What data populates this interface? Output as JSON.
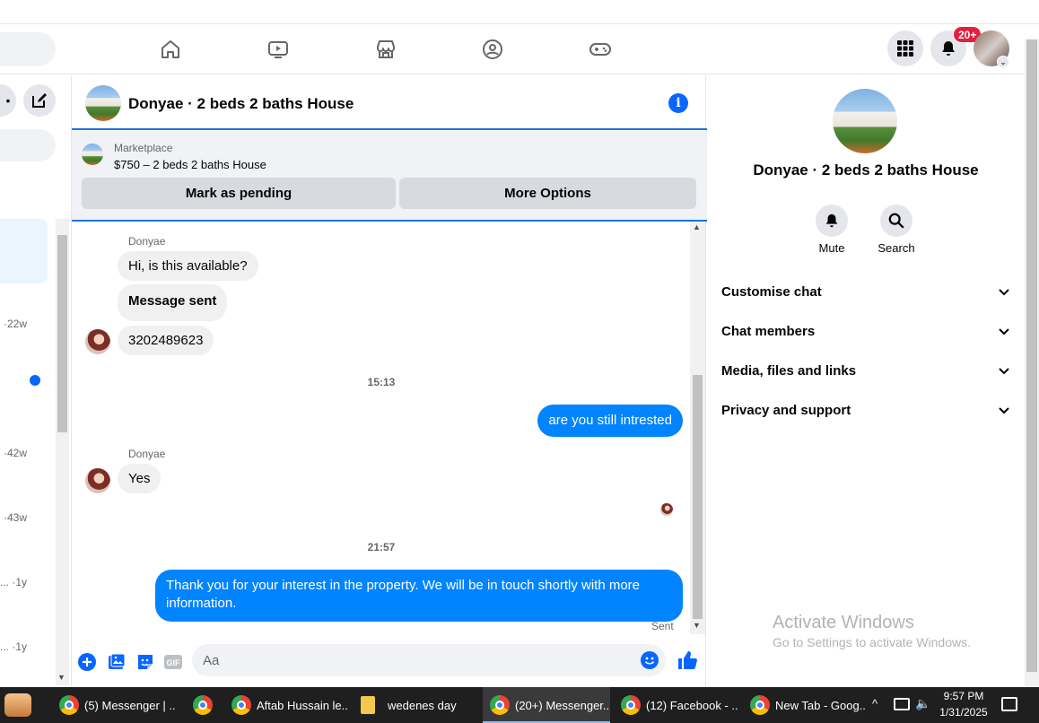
{
  "nav": {
    "notification_badge": "20+"
  },
  "left_sidebar": {
    "times": [
      "·22w",
      "·42w",
      "·43w",
      "... ·1y",
      "... ·1y"
    ]
  },
  "chat": {
    "title": "Donyae · 2 beds 2 baths House",
    "info_glyph": "i",
    "marketplace": {
      "label": "Marketplace",
      "description": "$750 – 2 beds 2 baths House",
      "mark_pending_label": "Mark as pending",
      "more_options_label": "More Options"
    },
    "messages": {
      "sender1": "Donyae",
      "m1": "Hi, is this available?",
      "m2": "Message sent",
      "m3": "3202489623",
      "ts1": "15:13",
      "m4": "are you still intrested",
      "sender2": "Donyae",
      "m5": "Yes",
      "ts2": "21:57",
      "m6": "Thank you for your interest in the property. We will be in touch shortly with more information.",
      "status": "Sent"
    },
    "composer": {
      "placeholder": "Aa"
    }
  },
  "right_panel": {
    "title": "Donyae · 2 beds 2 baths House",
    "mute_label": "Mute",
    "search_label": "Search",
    "sections": [
      "Customise chat",
      "Chat members",
      "Media, files and links",
      "Privacy and support"
    ],
    "watermark_title": "Activate Windows",
    "watermark_sub": "Go to Settings to activate Windows."
  },
  "taskbar": {
    "items": [
      "(5) Messenger | ...",
      "Aftab Hussain le...",
      "wedenes day",
      "(20+) Messenger...",
      "(12) Facebook - ...",
      "New Tab - Goog..."
    ],
    "time": "9:57 PM",
    "date": "1/31/2025"
  },
  "colors": {
    "accent": "#0866ff",
    "bubble_out": "#0084ff",
    "badge": "#e41e3f"
  }
}
